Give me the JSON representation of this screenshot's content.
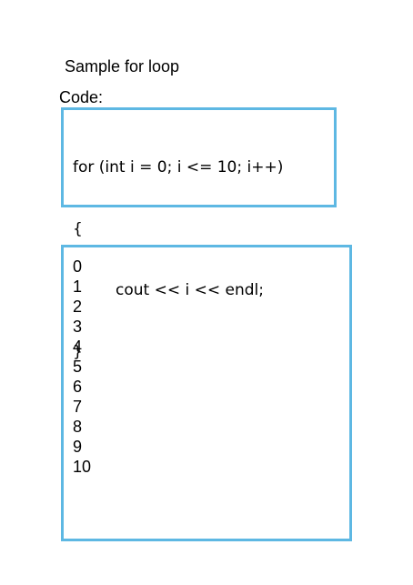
{
  "title": "Sample for loop",
  "code_label": "Code:",
  "code_lines": [
    "for (int i = 0; i <= 10; i++)",
    "{",
    "cout << i << endl;",
    "}"
  ],
  "output_lines": [
    "0",
    "1",
    "2",
    "3",
    "4",
    "5",
    "6",
    "7",
    "8",
    "9",
    "10"
  ],
  "colors": {
    "box_border": "#5eb8e3"
  }
}
